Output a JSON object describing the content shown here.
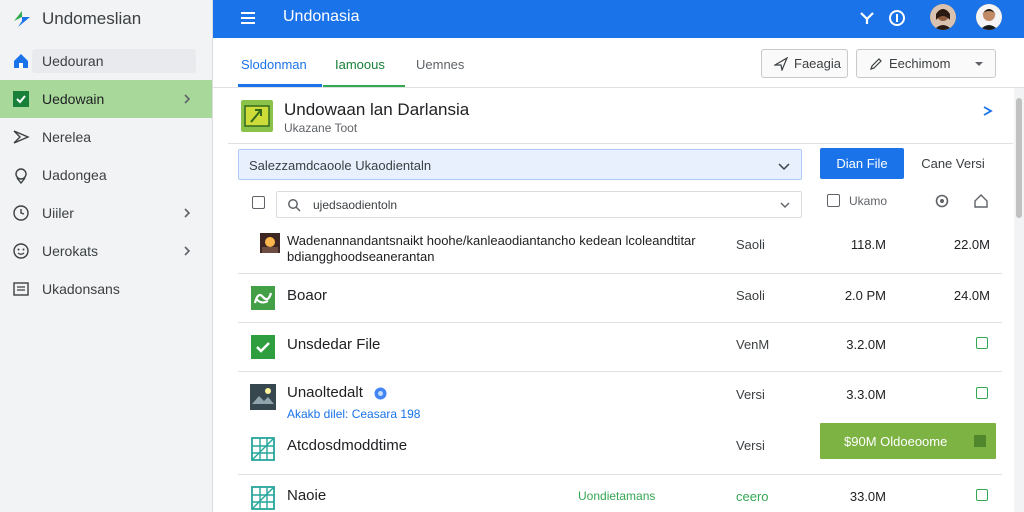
{
  "app": {
    "name": "Undomeslian"
  },
  "sidebar": {
    "items": [
      {
        "label": "Uedouran",
        "icon": "home-icon"
      },
      {
        "label": "Uedowain",
        "icon": "check-icon",
        "active": true,
        "has_chevron": true
      },
      {
        "label": "Nerelea",
        "icon": "send-icon"
      },
      {
        "label": "Uadongea",
        "icon": "location-icon"
      },
      {
        "label": "Uiiler",
        "icon": "clock-icon",
        "has_chevron": true
      },
      {
        "label": "Uerokats",
        "icon": "smile-icon",
        "has_chevron": true
      },
      {
        "label": "Ukadonsans",
        "icon": "list-icon"
      }
    ]
  },
  "topbar": {
    "title": "Undonasia"
  },
  "tabs": [
    {
      "label": "Slodonman",
      "state": "active-blue"
    },
    {
      "label": "Iamoous",
      "state": "active-green"
    },
    {
      "label": "Uemnes",
      "state": "inactive"
    }
  ],
  "toolbar": {
    "button1": "Faeagia",
    "button2": "Eechimom"
  },
  "header": {
    "title": "Undowaan lan Darlansia",
    "subtitle": "Ukazane Toot"
  },
  "filter": {
    "select_value": "Salezzamdcaoole Ukaodientaln",
    "primary_button": "Dian File",
    "secondary_button": "Cane Versi",
    "search_value": "ujedsaodientoln",
    "col_label": "Ukamo"
  },
  "rows": [
    {
      "name": "Wadenannandantsnaikt hoohe/kanleaodiantancho kedean lcoleandtitar bdiangghoodseanerantan",
      "kind": "Saoli",
      "size": "118.M",
      "size2": "22.0M",
      "icon": "image-thumb-icon"
    },
    {
      "name": "Boaor",
      "kind": "Saoli",
      "size": "2.0 PM",
      "size2": "24.0M",
      "icon": "green-doc-icon"
    },
    {
      "name": "Unsdedar File",
      "kind": "VenM",
      "size": "3.2.0M",
      "icon": "checkbox-green-icon"
    },
    {
      "name": "Unaoltedalt",
      "sub": "Akakb dilel: Ceasara 198",
      "kind": "Versi",
      "size": "3.3.0M",
      "icon": "image-thumb-icon",
      "badge": "verified-icon"
    },
    {
      "name": "Atcdosdmoddtime",
      "kind": "Versi",
      "bar": "$90M Oldoeoome",
      "icon": "grid-file-icon"
    },
    {
      "name": "Naoie",
      "green_text": "Uondietamans",
      "kind": "ceero",
      "size": "33.0M",
      "icon": "grid-file-icon"
    }
  ],
  "colors": {
    "primary": "#1a73e8",
    "active_nav": "#a8d99a",
    "green": "#7cb342"
  }
}
